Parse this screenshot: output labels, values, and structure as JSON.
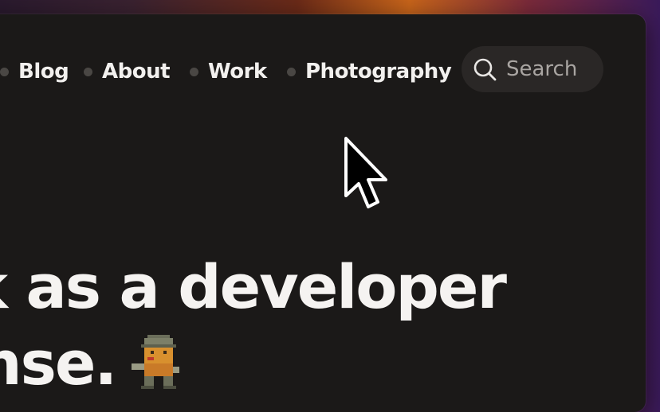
{
  "nav": {
    "items": [
      {
        "label": "Blog"
      },
      {
        "label": "About"
      },
      {
        "label": "Work"
      },
      {
        "label": "Photography"
      }
    ],
    "search": {
      "label": "Search",
      "icon": "search-icon"
    }
  },
  "hero": {
    "line1": "rk as a developer",
    "line2": "ense."
  },
  "colors": {
    "window_bg": "#1b1918",
    "text": "#f2f0ee",
    "muted": "#a9a5a2",
    "dot": "#4a4744"
  }
}
